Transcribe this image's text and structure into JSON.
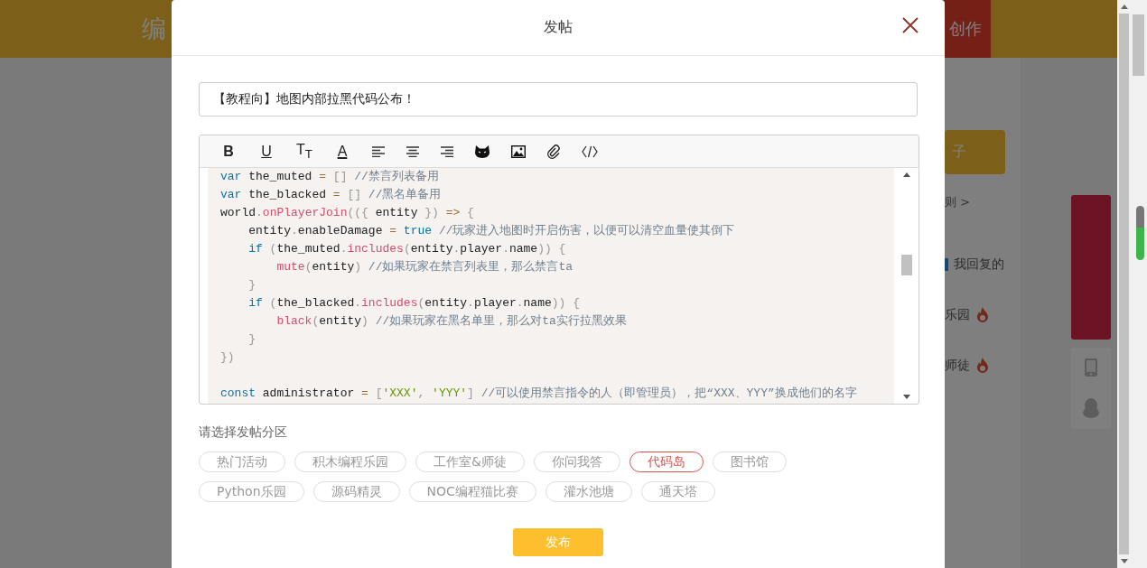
{
  "background_page": {
    "header": {
      "logo_fragment": "编",
      "create_button": "创作"
    },
    "right_panel": {
      "post_button": "子",
      "rules_link": "则 >",
      "items": [
        {
          "label": "我回复的",
          "marker": true,
          "fire": false
        },
        {
          "label": "乐园",
          "marker": false,
          "fire": true
        },
        {
          "label": "师徒",
          "marker": false,
          "fire": true
        }
      ]
    }
  },
  "modal": {
    "title": "发帖",
    "title_input": {
      "value": "【教程向】地图内部拉黑代码公布！"
    },
    "toolbar": [
      {
        "kind": "bold",
        "glyph": "B"
      },
      {
        "kind": "underline",
        "glyph": "U"
      },
      {
        "kind": "size",
        "glyph": "T$_{T}$"
      },
      {
        "kind": "color",
        "glyph": "A"
      },
      {
        "kind": "align_left"
      },
      {
        "kind": "align_center"
      },
      {
        "kind": "align_right"
      },
      {
        "kind": "emoji"
      },
      {
        "kind": "image"
      },
      {
        "kind": "attachment"
      },
      {
        "kind": "code"
      }
    ],
    "code_lines": [
      {
        "tokens": [
          {
            "kind": "keyword",
            "text": "var"
          },
          {
            "kind": "plain",
            "text": " the_muted "
          },
          {
            "kind": "operator",
            "text": "="
          },
          {
            "kind": "punctuation",
            "text": " [] "
          },
          {
            "kind": "comment",
            "text": "//禁言列表备用"
          }
        ]
      },
      {
        "tokens": [
          {
            "kind": "keyword",
            "text": "var"
          },
          {
            "kind": "plain",
            "text": " the_blacked "
          },
          {
            "kind": "operator",
            "text": "="
          },
          {
            "kind": "punctuation",
            "text": " [] "
          },
          {
            "kind": "comment",
            "text": "//黑名单备用"
          }
        ]
      },
      {
        "tokens": [
          {
            "kind": "plain",
            "text": "world"
          },
          {
            "kind": "punctuation",
            "text": "."
          },
          {
            "kind": "function",
            "text": "onPlayerJoin"
          },
          {
            "kind": "punctuation",
            "text": "(({"
          },
          {
            "kind": "plain",
            "text": " entity "
          },
          {
            "kind": "punctuation",
            "text": "})"
          },
          {
            "kind": "operator",
            "text": " => "
          },
          {
            "kind": "punctuation",
            "text": "{"
          }
        ]
      },
      {
        "tokens": [
          {
            "kind": "plain",
            "text": "    entity"
          },
          {
            "kind": "punctuation",
            "text": "."
          },
          {
            "kind": "plain",
            "text": "enableDamage "
          },
          {
            "kind": "operator",
            "text": "="
          },
          {
            "kind": "keyword",
            "text": " true"
          },
          {
            "kind": "comment",
            "text": " //玩家进入地图时开启伤害，以便可以清空血量使其倒下"
          }
        ]
      },
      {
        "tokens": [
          {
            "kind": "keyword",
            "text": "    if"
          },
          {
            "kind": "punctuation",
            "text": " ("
          },
          {
            "kind": "plain",
            "text": "the_muted"
          },
          {
            "kind": "punctuation",
            "text": "."
          },
          {
            "kind": "function",
            "text": "includes"
          },
          {
            "kind": "punctuation",
            "text": "("
          },
          {
            "kind": "plain",
            "text": "entity"
          },
          {
            "kind": "punctuation",
            "text": "."
          },
          {
            "kind": "plain",
            "text": "player"
          },
          {
            "kind": "punctuation",
            "text": "."
          },
          {
            "kind": "plain",
            "text": "name"
          },
          {
            "kind": "punctuation",
            "text": ")) {"
          }
        ]
      },
      {
        "tokens": [
          {
            "kind": "function",
            "text": "        mute"
          },
          {
            "kind": "punctuation",
            "text": "("
          },
          {
            "kind": "plain",
            "text": "entity"
          },
          {
            "kind": "punctuation",
            "text": ")"
          },
          {
            "kind": "comment",
            "text": " //如果玩家在禁言列表里，那么禁言ta"
          }
        ]
      },
      {
        "tokens": [
          {
            "kind": "punctuation",
            "text": "    }"
          }
        ]
      },
      {
        "tokens": [
          {
            "kind": "keyword",
            "text": "    if"
          },
          {
            "kind": "punctuation",
            "text": " ("
          },
          {
            "kind": "plain",
            "text": "the_blacked"
          },
          {
            "kind": "punctuation",
            "text": "."
          },
          {
            "kind": "function",
            "text": "includes"
          },
          {
            "kind": "punctuation",
            "text": "("
          },
          {
            "kind": "plain",
            "text": "entity"
          },
          {
            "kind": "punctuation",
            "text": "."
          },
          {
            "kind": "plain",
            "text": "player"
          },
          {
            "kind": "punctuation",
            "text": "."
          },
          {
            "kind": "plain",
            "text": "name"
          },
          {
            "kind": "punctuation",
            "text": ")) {"
          }
        ]
      },
      {
        "tokens": [
          {
            "kind": "function",
            "text": "        black"
          },
          {
            "kind": "punctuation",
            "text": "("
          },
          {
            "kind": "plain",
            "text": "entity"
          },
          {
            "kind": "punctuation",
            "text": ")"
          },
          {
            "kind": "comment",
            "text": " //如果玩家在黑名单里，那么对ta实行拉黑效果"
          }
        ]
      },
      {
        "tokens": [
          {
            "kind": "punctuation",
            "text": "    }"
          }
        ]
      },
      {
        "tokens": [
          {
            "kind": "punctuation",
            "text": "})"
          }
        ]
      },
      {
        "gap_before": true,
        "tokens": [
          {
            "kind": "keyword",
            "text": "const"
          },
          {
            "kind": "plain",
            "text": " administrator "
          },
          {
            "kind": "operator",
            "text": "="
          },
          {
            "kind": "punctuation",
            "text": " ["
          },
          {
            "kind": "string",
            "text": "'XXX'"
          },
          {
            "kind": "punctuation",
            "text": ", "
          },
          {
            "kind": "string",
            "text": "'YYY'"
          },
          {
            "kind": "punctuation",
            "text": "]"
          },
          {
            "kind": "comment",
            "text": " //可以使用禁言指令的人（即管理员），把“XXX、YYY”换成他们的名字"
          }
        ]
      }
    ],
    "section_label": "请选择发帖分区",
    "category_rows": [
      [
        {
          "label": "热门活动",
          "selected": false
        },
        {
          "label": "积木编程乐园",
          "selected": false
        },
        {
          "label": "工作室&师徒",
          "selected": false
        },
        {
          "label": "你问我答",
          "selected": false
        },
        {
          "label": "代码岛",
          "selected": true
        },
        {
          "label": "图书馆",
          "selected": false
        }
      ],
      [
        {
          "label": "Python乐园",
          "selected": false
        },
        {
          "label": "源码精灵",
          "selected": false
        },
        {
          "label": "NOC编程猫比赛",
          "selected": false
        },
        {
          "label": "灌水池塘",
          "selected": false
        },
        {
          "label": "通天塔",
          "selected": false
        }
      ]
    ],
    "submit_button": "发布"
  }
}
